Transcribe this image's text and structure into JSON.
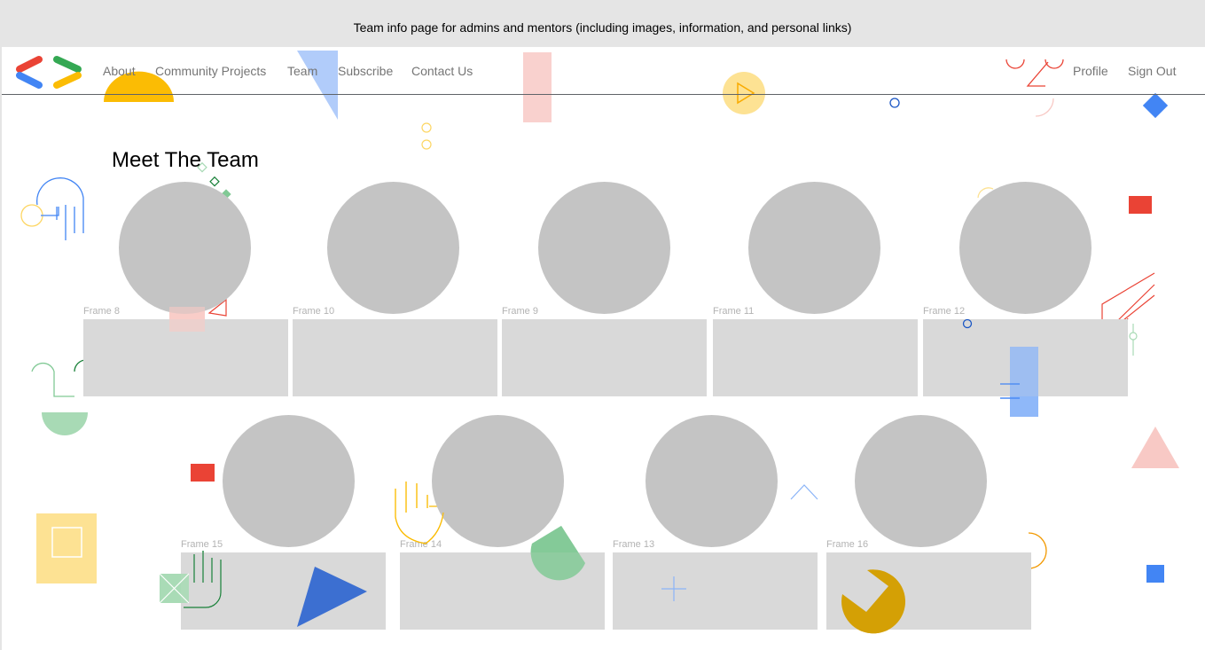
{
  "banner": {
    "text": "Team info page for admins and mentors (including images, information, and personal links)"
  },
  "nav": {
    "logo_icon": "developer-code-brackets-logo",
    "items": [
      {
        "label": "About"
      },
      {
        "label": "Community Projects"
      },
      {
        "label": "Team"
      },
      {
        "label": "Subscribe"
      },
      {
        "label": "Contact Us"
      }
    ],
    "right_items": [
      {
        "label": "Profile"
      },
      {
        "label": "Sign Out"
      }
    ]
  },
  "page": {
    "title": "Meet The Team"
  },
  "team_row1": [
    {
      "frame": "Frame 8"
    },
    {
      "frame": "Frame 10"
    },
    {
      "frame": "Frame 9"
    },
    {
      "frame": "Frame 11"
    },
    {
      "frame": "Frame 12"
    }
  ],
  "team_row2": [
    {
      "frame": "Frame 15"
    },
    {
      "frame": "Frame 14"
    },
    {
      "frame": "Frame 13"
    },
    {
      "frame": "Frame 16"
    }
  ],
  "colors": {
    "blue": "#4285f4",
    "red": "#ea4335",
    "yellow": "#fbbc04",
    "green": "#34a853",
    "placeholder": "#c4c4c4",
    "card": "#d9d9d9"
  }
}
